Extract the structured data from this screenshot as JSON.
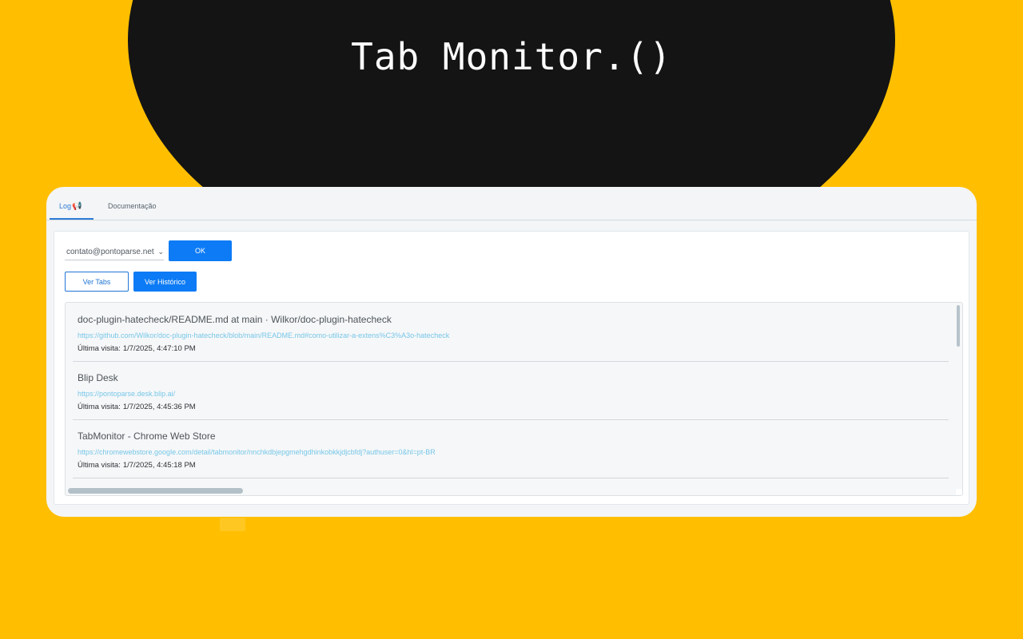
{
  "hero": {
    "title": "Tab Monitor.()"
  },
  "tabs": [
    {
      "label": "Log",
      "icon": "megaphone-icon",
      "active": true
    },
    {
      "label": "Documentação",
      "active": false
    }
  ],
  "account": {
    "selected": "contato@pontoparse.net"
  },
  "buttons": {
    "ok": "OK",
    "ver_tabs": "Ver Tabs",
    "ver_historico": "Ver Histórico"
  },
  "history": [
    {
      "title": "doc-plugin-hatecheck/README.md at main · Wilkor/doc-plugin-hatecheck",
      "url": "https://github.com/Wilkor/doc-plugin-hatecheck/blob/main/README.md#como-utilizar-a-extens%C3%A3o-hatecheck",
      "visit_label": "Última visita:",
      "visit_time": "1/7/2025, 4:47:10 PM"
    },
    {
      "title": "Blip Desk",
      "url": "https://pontoparse.desk.blip.ai/",
      "visit_label": "Última visita:",
      "visit_time": "1/7/2025, 4:45:36 PM"
    },
    {
      "title": "TabMonitor - Chrome Web Store",
      "url": "https://chromewebstore.google.com/detail/tabmonitor/nnchkdbjepgmehgdhinkobkkjdjcbfdj?authuser=0&hl=pt-BR",
      "visit_label": "Última visita:",
      "visit_time": "1/7/2025, 4:45:18 PM"
    }
  ],
  "colors": {
    "background": "#ffbf00",
    "blob": "#141414",
    "accent": "#0d7bf5",
    "link": "#76c7e9"
  }
}
